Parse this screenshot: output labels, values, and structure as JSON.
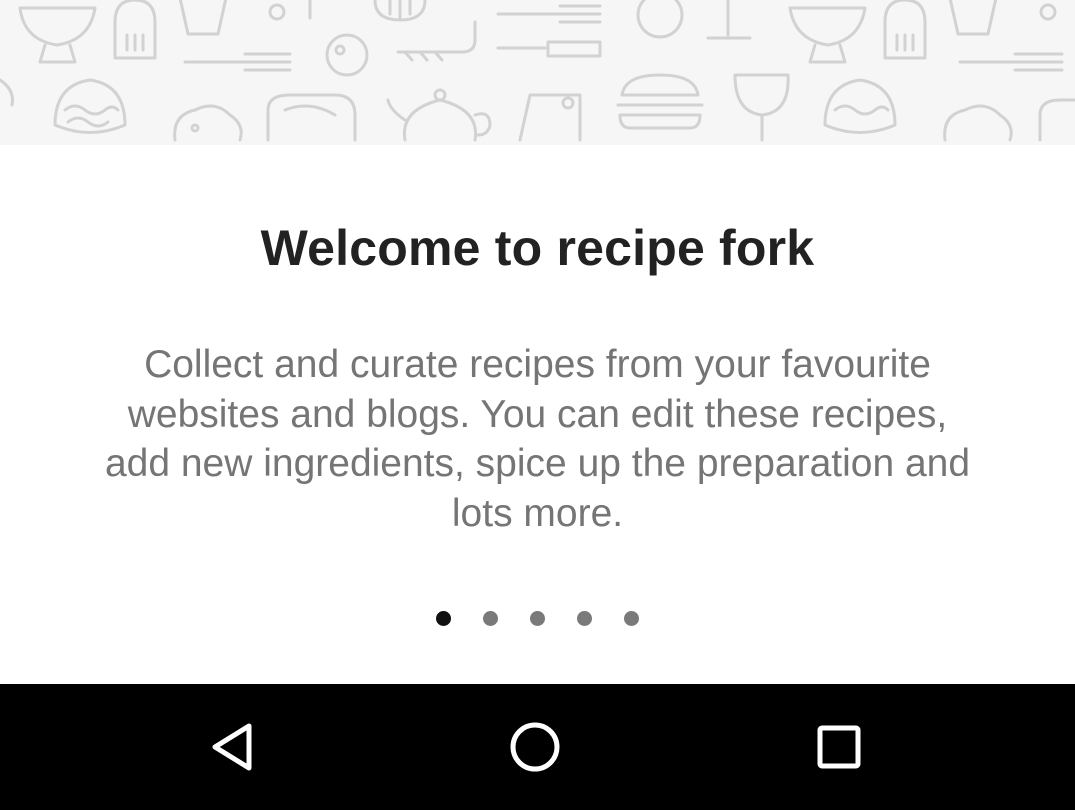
{
  "onboarding": {
    "title": "Welcome to recipe fork",
    "description": "Collect and curate recipes from your favourite websites and blogs. You can edit these recipes, add new ingredients, spice up the preparation and lots more.",
    "current_page": 1,
    "page_count": 5
  },
  "banner": {
    "icons": [
      "cupcake-icon",
      "spatula-icon",
      "cup-icon",
      "fork-icon",
      "apple-icon",
      "wine-glass-icon",
      "burger-icon",
      "teapot-icon",
      "cleaver-icon",
      "steak-icon",
      "pie-icon",
      "chicken-icon",
      "bowl-icon"
    ]
  },
  "navbar": {
    "buttons": [
      "back-icon",
      "home-icon",
      "recents-icon"
    ]
  },
  "colors": {
    "background": "#ffffff",
    "banner_background": "#f6f6f6",
    "banner_icon_stroke": "#d2d2d2",
    "title": "#222222",
    "description": "#757575",
    "dot_active": "#111111",
    "dot_inactive": "#7a7a7a",
    "navbar": "#000000"
  }
}
